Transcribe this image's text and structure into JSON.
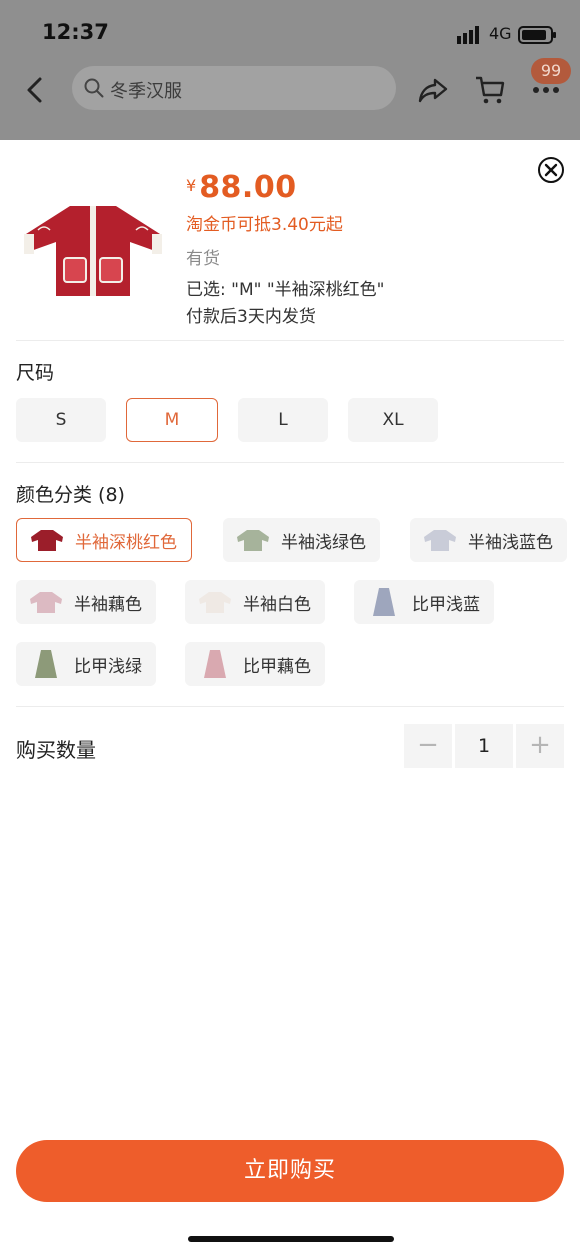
{
  "status_bar": {
    "time": "12:37",
    "network": "4G"
  },
  "search": {
    "query": "冬季汉服"
  },
  "header": {
    "cart_badge": "99"
  },
  "product": {
    "price_symbol": "¥",
    "price": "88.00",
    "coin_note": "淘金币可抵3.40元起",
    "stock": "有货",
    "selected": "已选: \"M\" \"半袖深桃红色\"",
    "shipping": "付款后3天内发货"
  },
  "size": {
    "title": "尺码",
    "options": [
      "S",
      "M",
      "L",
      "XL"
    ],
    "selected": "M"
  },
  "color": {
    "title": "颜色分类 (8)",
    "options": [
      "半袖深桃红色",
      "半袖浅绿色",
      "半袖浅蓝色",
      "半袖藕色",
      "半袖白色",
      "比甲浅蓝",
      "比甲浅绿",
      "比甲藕色"
    ],
    "selected": "半袖深桃红色"
  },
  "quantity": {
    "label": "购买数量",
    "value": "1",
    "minus": "−",
    "plus": "+"
  },
  "buy_button": "立即购买",
  "colors": {
    "accent": "#ee5d2b",
    "price": "#e35c22"
  }
}
